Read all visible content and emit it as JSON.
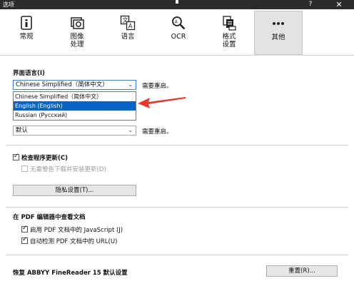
{
  "window": {
    "title": "选项",
    "help_label": "?",
    "close_label": "✕"
  },
  "tabs": [
    {
      "label": "常规",
      "icon": "info-card-icon"
    },
    {
      "label": "图像\n处理",
      "icon": "image-processing-icon"
    },
    {
      "label": "语言",
      "icon": "language-icon"
    },
    {
      "label": "OCR",
      "icon": "ocr-magnifier-icon"
    },
    {
      "label": "格式\n设置",
      "icon": "format-settings-icon"
    },
    {
      "label": "其他",
      "icon": "more-dots-icon",
      "active": true
    }
  ],
  "ui_language": {
    "label": "界面语言(I)",
    "selected": "Chinese Simplified（简体中文）",
    "restart_note": "需要重启。",
    "options": [
      "Chinese Simplified（简体中文）",
      "English (English)",
      "Russian (Русский)"
    ],
    "highlighted_index": 1
  },
  "second_select": {
    "value": "默认",
    "restart_note": "需要重启。"
  },
  "updates": {
    "check_label": "检查程序更新(C)",
    "check_checked": true,
    "silent_label": "无需警告下载并安装更新(D)",
    "silent_checked": false,
    "privacy_button": "隐私设置(T)..."
  },
  "pdf_section": {
    "heading": "在 PDF 编辑器中查看文档",
    "javascript_label": "启用 PDF 文档中的 JavaScript (J)",
    "javascript_checked": true,
    "url_label": "自动检测 PDF 文档中的 URL(U)",
    "url_checked": true
  },
  "restore": {
    "label": "恢复 ABBYY FineReader 15 默认设置",
    "reset_button": "重置(R)..."
  },
  "colors": {
    "titlebar": "#2b2b2b",
    "selection": "#0a64c8",
    "arrow": "#e8392c"
  }
}
